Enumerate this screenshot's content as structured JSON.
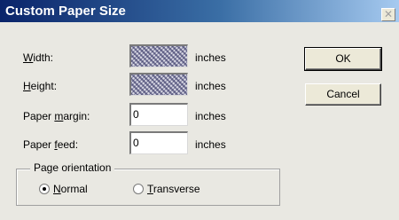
{
  "dialog": {
    "title": "Custom Paper Size",
    "close_glyph": "✕"
  },
  "fields": {
    "width_label_key": "W",
    "width_label_rest": "idth:",
    "width_value": "",
    "width_unit": "inches",
    "height_label_key": "H",
    "height_label_rest": "eight:",
    "height_value": "",
    "height_unit": "inches",
    "margin_label_pre": "Paper ",
    "margin_label_key": "m",
    "margin_label_rest": "argin:",
    "margin_value": "0",
    "margin_unit": "inches",
    "feed_label_pre": "Paper ",
    "feed_label_key": "f",
    "feed_label_rest": "eed:",
    "feed_value": "0",
    "feed_unit": "inches"
  },
  "buttons": {
    "ok_label": "OK",
    "cancel_label": "Cancel"
  },
  "orientation": {
    "legend": "Page orientation",
    "normal_key": "N",
    "normal_rest": "ormal",
    "transverse_key": "T",
    "transverse_rest": "ransverse",
    "selected": "normal"
  }
}
